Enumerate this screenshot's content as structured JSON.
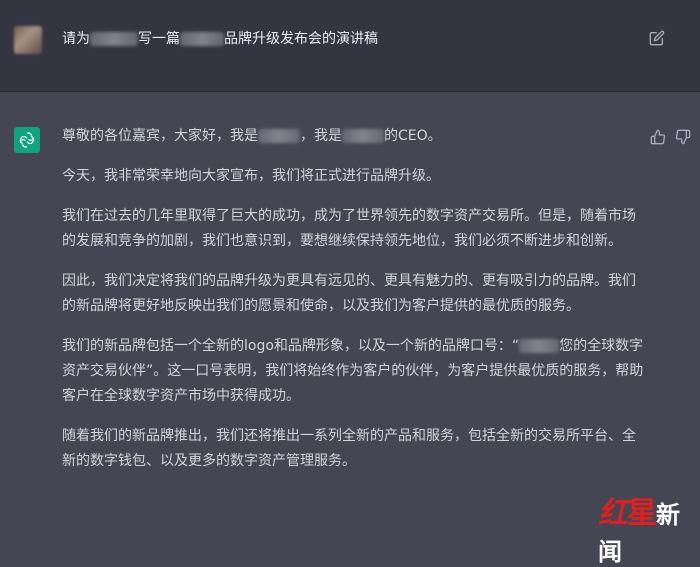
{
  "user_prompt": {
    "part1": "请为",
    "part2": "写一篇",
    "part3": "品牌升级发布会的演讲稿"
  },
  "response": {
    "p1": {
      "a": "尊敬的各位嘉宾，大家好，我是",
      "b": "，我是",
      "c": "的CEO。"
    },
    "p2": "今天，我非常荣幸地向大家宣布，我们将正式进行品牌升级。",
    "p3": "我们在过去的几年里取得了巨大的成功，成为了世界领先的数字资产交易所。但是，随着市场的发展和竞争的加剧，我们也意识到，要想继续保持领先地位，我们必须不断进步和创新。",
    "p4": "因此，我们决定将我们的品牌升级为更具有远见的、更具有魅力的、更有吸引力的品牌。我们的新品牌将更好地反映出我们的愿景和使命，以及我们为客户提供的最优质的服务。",
    "p5": {
      "a": "我们的新品牌包括一个全新的logo和品牌形象，以及一个新的品牌口号：“",
      "b": "您的全球数字资产交易伙伴”。这一口号表明，我们将始终作为客户的伙伴，为客户提供最优质的服务，帮助客户在全球数字资产市场中获得成功。"
    },
    "p6": "随着我们的新品牌推出，我们还将推出一系列全新的产品和服务，包括全新的交易所平台、全新的数字钱包、以及更多的数字资产管理服务。"
  },
  "watermark": {
    "hong": "红",
    "xing": "星",
    "rest": "新闻"
  },
  "icons": {
    "edit": "edit-icon",
    "assistant_logo": "openai-logo-icon",
    "thumbs_up": "thumbs-up-icon",
    "thumbs_down": "thumbs-down-icon"
  },
  "colors": {
    "user_bg": "#343541",
    "assistant_bg": "#444654",
    "accent": "#10a37f",
    "text": "#d1d5db"
  }
}
